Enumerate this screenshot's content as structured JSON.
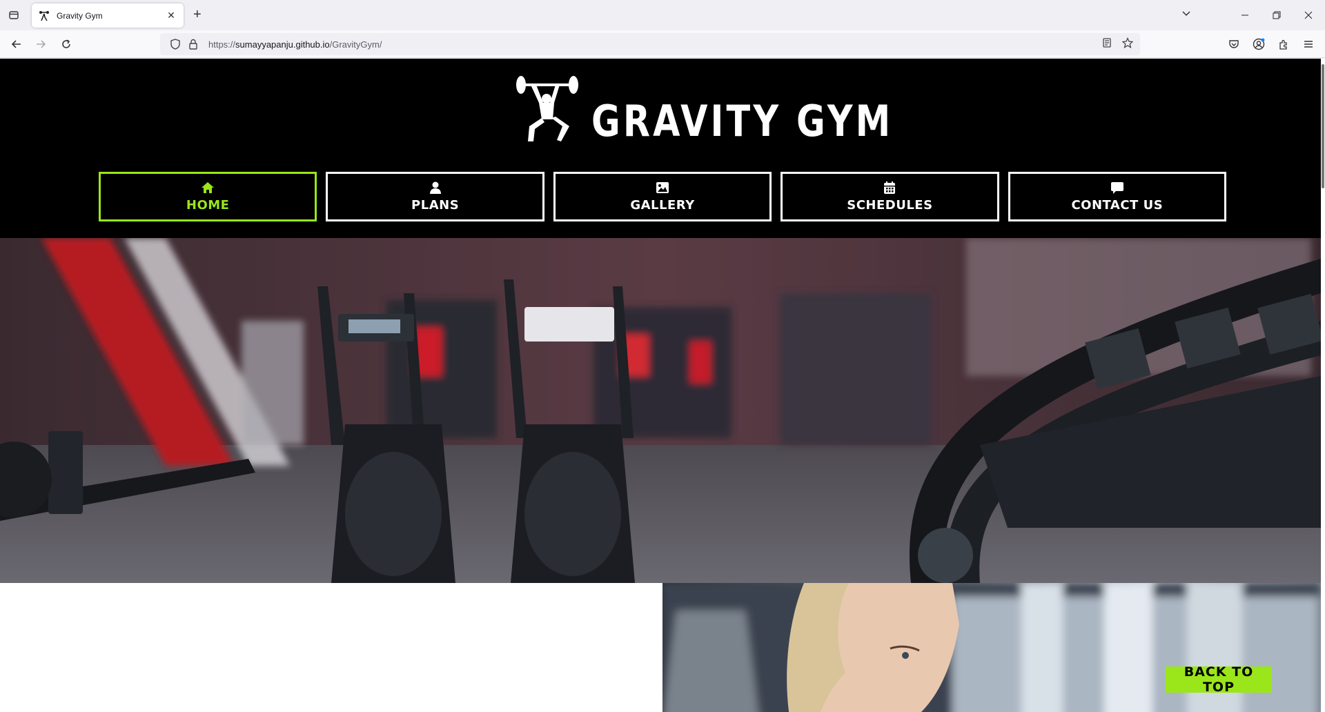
{
  "browser": {
    "tab": {
      "title": "Gravity Gym"
    },
    "url": {
      "scheme": "https://",
      "host": "sumayyapanju.github.io",
      "path": "/GravityGym/"
    }
  },
  "site": {
    "brand_name": "GRAVITY GYM",
    "accent_color": "#9be61a",
    "menu": [
      {
        "label": "HOME",
        "icon": "home-icon",
        "active": true
      },
      {
        "label": "PLANS",
        "icon": "user-icon",
        "active": false
      },
      {
        "label": "GALLERY",
        "icon": "image-icon",
        "active": false
      },
      {
        "label": "SCHEDULES",
        "icon": "calendar-icon",
        "active": false
      },
      {
        "label": "CONTACT US",
        "icon": "chat-icon",
        "active": false
      }
    ],
    "back_to_top": "BACK TO TOP"
  }
}
